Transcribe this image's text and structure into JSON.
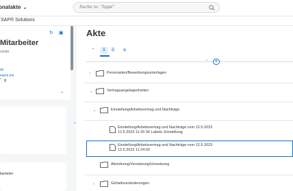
{
  "shell": {
    "app_title": "onalakte",
    "search_placeholder": "Suche in: \"Apps\""
  },
  "subbar": {
    "org": "SAP® Solutions"
  },
  "employee": {
    "name": "Mitarbeiter",
    "role": "ociate",
    "phone": "42",
    "teams": "eams.ms"
  },
  "card2": {
    "label": "itarbeiter"
  },
  "main": {
    "title": "Akte",
    "tree": [
      {
        "label": "Personalien/Bewerbungsunterlagen",
        "expanded": false
      },
      {
        "label": "Vertragsangelegenheiten",
        "expanded": true
      },
      {
        "label": "Einstellung/Arbeitsvertrag und Nachträge",
        "expanded": true
      },
      {
        "label": "Abordnung/Versetzung/Umsetzung",
        "expanded": false
      },
      {
        "label": "Gehaltsveränderungen",
        "expanded": false
      }
    ],
    "documents": [
      {
        "line1": "Einstellung/Arbeitsvertrag und Nachträge vom 12.5.2023",
        "line2": "12.5.2023 11:26:36   Labels: Einstellung"
      },
      {
        "line1": "Einstellung/Arbeitsvertrag und Nachträge vom 12.5.2023",
        "line2": "12.5.2023 11:24:00"
      }
    ]
  },
  "colors": {
    "accent": "#0a6ed1",
    "text": "#32363a",
    "background": "#f5f6f7"
  },
  "icons": [
    "chevron-down-icon",
    "search-icon",
    "refresh-icon",
    "folder-icon",
    "document-icon",
    "collapse-icon",
    "expand-icon"
  ]
}
